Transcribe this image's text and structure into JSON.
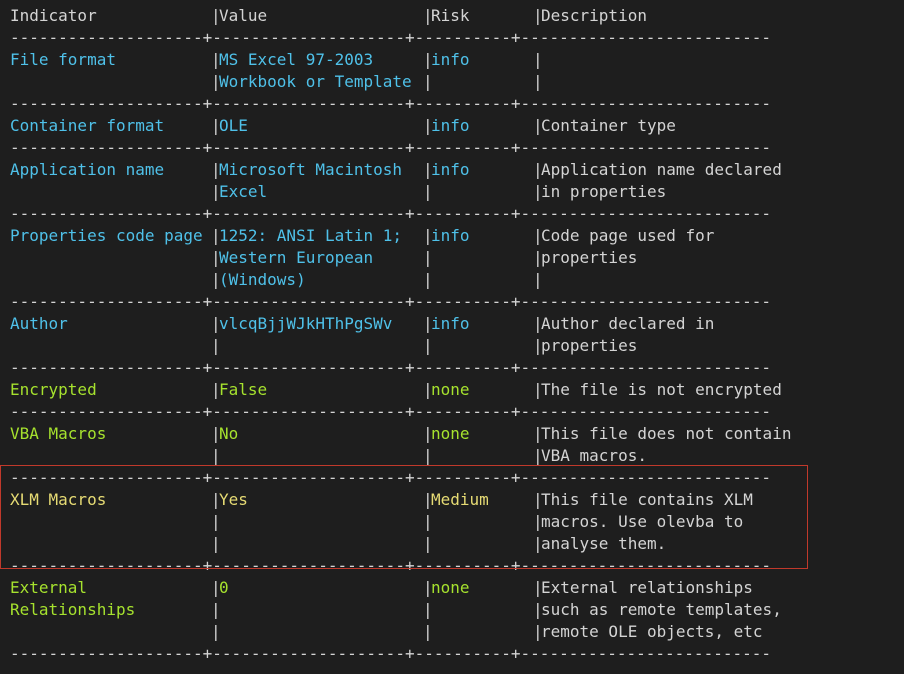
{
  "headers": {
    "indicator": "Indicator",
    "value": "Value",
    "risk": "Risk",
    "description": "Description"
  },
  "divider": "---------------------------------------------------------------------------------------------------------------",
  "rows": [
    {
      "risk_level": "info",
      "lines": [
        [
          "File format",
          "MS Excel 97-2003",
          "info",
          ""
        ],
        [
          "",
          "Workbook or Template",
          "",
          ""
        ]
      ]
    },
    {
      "risk_level": "info",
      "lines": [
        [
          "Container format",
          "OLE",
          "info",
          "Container type"
        ]
      ]
    },
    {
      "risk_level": "info",
      "lines": [
        [
          "Application name",
          "Microsoft Macintosh",
          "info",
          "Application name declared"
        ],
        [
          "",
          "Excel",
          "",
          "in properties"
        ]
      ]
    },
    {
      "risk_level": "info",
      "lines": [
        [
          "Properties code page",
          "1252: ANSI Latin 1;",
          "info",
          "Code page used for"
        ],
        [
          "",
          "Western European",
          "",
          "properties"
        ],
        [
          "",
          "(Windows)",
          "",
          ""
        ]
      ]
    },
    {
      "risk_level": "info",
      "lines": [
        [
          "Author",
          "vlcqBjjWJkHThPgSWv",
          "info",
          "Author declared in"
        ],
        [
          "",
          "",
          "",
          "properties"
        ]
      ]
    },
    {
      "risk_level": "none",
      "lines": [
        [
          "Encrypted",
          "False",
          "none",
          "The file is not encrypted"
        ]
      ]
    },
    {
      "risk_level": "none",
      "lines": [
        [
          "VBA Macros",
          "No",
          "none",
          "This file does not contain"
        ],
        [
          "",
          "",
          "",
          "VBA macros."
        ]
      ]
    },
    {
      "risk_level": "medium",
      "lines": [
        [
          "XLM Macros",
          "Yes",
          "Medium",
          "This file contains XLM"
        ],
        [
          "",
          "",
          "",
          "macros. Use olevba to"
        ],
        [
          "",
          "",
          "",
          "analyse them."
        ]
      ]
    },
    {
      "risk_level": "none",
      "lines": [
        [
          "External",
          "0",
          "none",
          "External relationships"
        ],
        [
          "Relationships",
          "",
          "",
          "such as remote templates,"
        ],
        [
          "",
          "",
          "",
          "remote OLE objects, etc"
        ]
      ]
    }
  ],
  "colors": {
    "info": "#4fc1e9",
    "none": "#a6e22e",
    "medium": "#e6db74",
    "highlight_border": "#c0392b"
  }
}
